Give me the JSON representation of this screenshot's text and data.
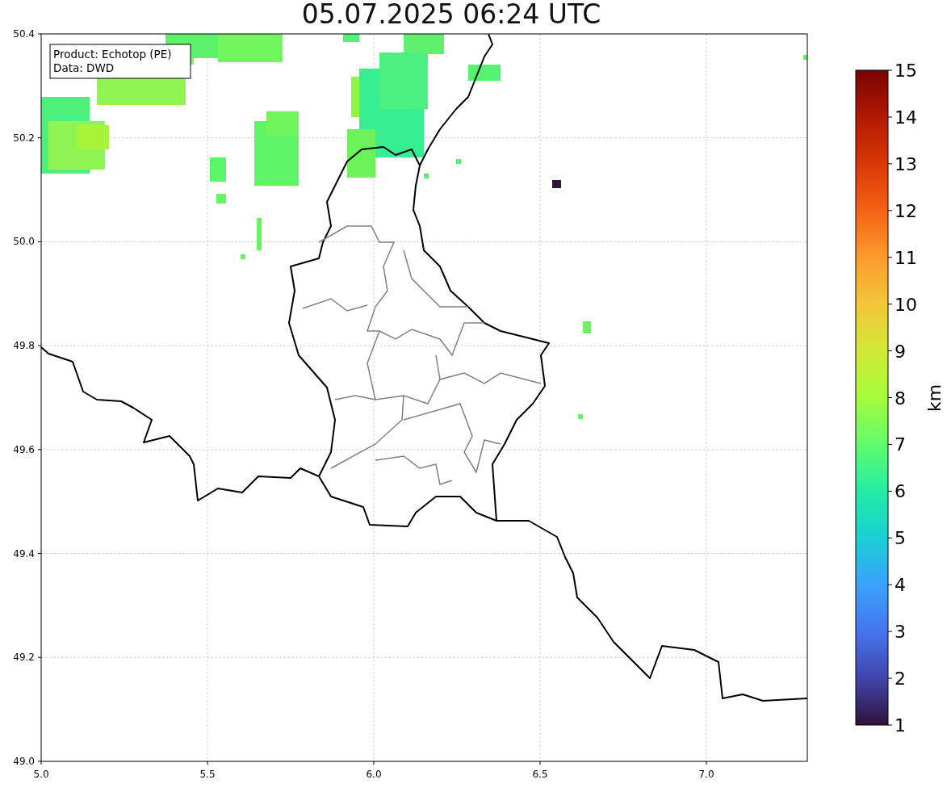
{
  "title": "05.07.2025 06:24 UTC",
  "legend": [
    "Product: Echotop (PE)",
    "Data: DWD"
  ],
  "x_ticks": [
    "5.0",
    "5.5",
    "6.0",
    "6.5",
    "7.0"
  ],
  "y_ticks": [
    "50.4",
    "50.2",
    "50.0",
    "49.8",
    "49.6",
    "49.4",
    "49.2",
    "49.0"
  ],
  "colorbar": {
    "label": "km",
    "ticks": [
      "15",
      "14",
      "13",
      "12",
      "11",
      "10",
      "9",
      "8",
      "7",
      "6",
      "5",
      "4",
      "3",
      "2",
      "1"
    ]
  }
}
